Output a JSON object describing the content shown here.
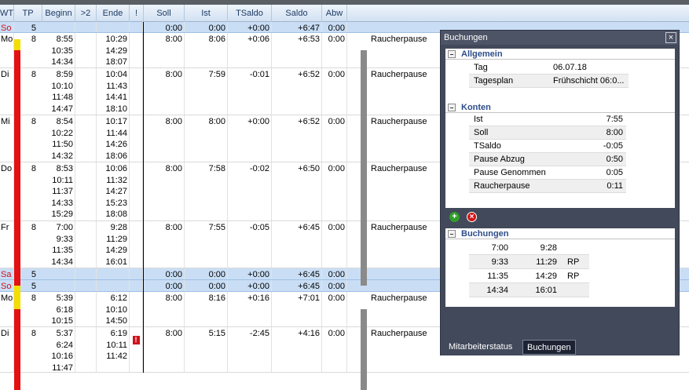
{
  "header": {
    "cols": [
      "WT",
      "TP",
      "Beginn",
      ">2",
      "Ende",
      "!",
      "Soll",
      "Ist",
      "TSaldo",
      "Saldo",
      "Abw"
    ]
  },
  "rows": [
    {
      "wt": "So",
      "tp": "5",
      "beginn": "",
      "ende": "",
      "soll": "0:00",
      "ist": "0:00",
      "tsaldo": "+0:00",
      "saldo": "+6:47",
      "abw": "0:00",
      "bem": "",
      "highlight": true,
      "weekend": true,
      "tpcolor": "#f2de00"
    },
    {
      "wt": "Mo",
      "tp": "8",
      "beginn": "8:55\n10:35\n14:34",
      "ende": "10:29\n14:29\n18:07",
      "soll": "8:00",
      "ist": "8:06",
      "tsaldo": "+0:06",
      "saldo": "+6:53",
      "abw": "0:00",
      "bem": "Raucherpause",
      "highlight": false,
      "weekend": false,
      "tpcolor": "#e31111"
    },
    {
      "wt": "Di",
      "tp": "8",
      "beginn": "8:59\n10:10\n11:48\n14:47",
      "ende": "10:04\n11:43\n14:41\n18:10",
      "soll": "8:00",
      "ist": "7:59",
      "tsaldo": "-0:01",
      "saldo": "+6:52",
      "abw": "0:00",
      "bem": "Raucherpause",
      "highlight": false,
      "weekend": false,
      "tpcolor": "#e31111"
    },
    {
      "wt": "Mi",
      "tp": "8",
      "beginn": "8:54\n10:22\n11:50\n14:32",
      "ende": "10:17\n11:44\n14:26\n18:06",
      "soll": "8:00",
      "ist": "8:00",
      "tsaldo": "+0:00",
      "saldo": "+6:52",
      "abw": "0:00",
      "bem": "Raucherpause",
      "highlight": false,
      "weekend": false,
      "tpcolor": "#e31111"
    },
    {
      "wt": "Do",
      "tp": "8",
      "beginn": "8:53\n10:11\n11:37\n14:33\n15:29",
      "ende": "10:06\n11:32\n14:27\n15:23\n18:08",
      "soll": "8:00",
      "ist": "7:58",
      "tsaldo": "-0:02",
      "saldo": "+6:50",
      "abw": "0:00",
      "bem": "Raucherpause",
      "highlight": false,
      "weekend": false,
      "tpcolor": "#e31111"
    },
    {
      "wt": "Fr",
      "tp": "8",
      "beginn": "7:00\n9:33\n11:35\n14:34",
      "ende": "9:28\n11:29\n14:29\n16:01",
      "soll": "8:00",
      "ist": "7:55",
      "tsaldo": "-0:05",
      "saldo": "+6:45",
      "abw": "0:00",
      "bem": "Raucherpause",
      "highlight": false,
      "weekend": false,
      "tpcolor": "#e31111"
    },
    {
      "wt": "Sa",
      "tp": "5",
      "beginn": "",
      "ende": "",
      "soll": "0:00",
      "ist": "0:00",
      "tsaldo": "+0:00",
      "saldo": "+6:45",
      "abw": "0:00",
      "bem": "",
      "highlight": true,
      "weekend": true,
      "tpcolor": "#f2de00"
    },
    {
      "wt": "So",
      "tp": "5",
      "beginn": "",
      "ende": "",
      "soll": "0:00",
      "ist": "0:00",
      "tsaldo": "+0:00",
      "saldo": "+6:45",
      "abw": "0:00",
      "bem": "",
      "highlight": true,
      "weekend": true,
      "tpcolor": "#f2de00"
    },
    {
      "wt": "Mo",
      "tp": "8",
      "beginn": "5:39\n6:18\n10:15",
      "ende": "6:12\n10:10\n14:50",
      "soll": "8:00",
      "ist": "8:16",
      "tsaldo": "+0:16",
      "saldo": "+7:01",
      "abw": "0:00",
      "bem": "Raucherpause",
      "highlight": false,
      "weekend": false,
      "tpcolor": "#e31111"
    },
    {
      "wt": "Di",
      "tp": "8",
      "beginn": "5:37\n6:24\n10:16\n11:47",
      "ende": "6:19\n10:11\n11:42",
      "soll": "8:00",
      "ist": "5:15",
      "tsaldo": "-2:45",
      "saldo": "+4:16",
      "abw": "0:00",
      "bem": "Raucherpause",
      "highlight": false,
      "weekend": false,
      "tpcolor": "#e31111",
      "warning": true
    }
  ],
  "panel": {
    "title": "Buchungen",
    "close": "×",
    "allgemein": {
      "title": "Allgemein",
      "items": [
        {
          "k": "Tag",
          "v": "06.07.18"
        },
        {
          "k": "Tagesplan",
          "v": "Frühschicht 06:0..."
        }
      ]
    },
    "konten": {
      "title": "Konten",
      "items": [
        {
          "k": "Ist",
          "v": "7:55"
        },
        {
          "k": "Soll",
          "v": "8:00"
        },
        {
          "k": "TSaldo",
          "v": "-0:05"
        },
        {
          "k": "Pause Abzug",
          "v": "0:50"
        },
        {
          "k": "Pause Genommen",
          "v": "0:05"
        },
        {
          "k": "Raucherpause",
          "v": "0:11"
        }
      ]
    },
    "buchungen": {
      "title": "Buchungen",
      "items": [
        {
          "kommen": "7:00",
          "gehen": "9:28",
          "code": ""
        },
        {
          "kommen": "9:33",
          "gehen": "11:29",
          "code": "RP"
        },
        {
          "kommen": "11:35",
          "gehen": "14:29",
          "code": "RP"
        },
        {
          "kommen": "14:34",
          "gehen": "16:01",
          "code": ""
        }
      ]
    },
    "tabs": [
      "Mitarbeiterstatus",
      "Buchungen"
    ],
    "active_tab": 1
  },
  "colors": {
    "accent": "#2d4d89",
    "weekend_row": "#c9def5",
    "tp_work": "#e31111",
    "tp_free": "#f2de00",
    "panel_bg": "#42495a"
  },
  "icons": {
    "add": "plus-circle-icon",
    "delete": "x-circle-icon",
    "warning": "exclamation-icon"
  }
}
